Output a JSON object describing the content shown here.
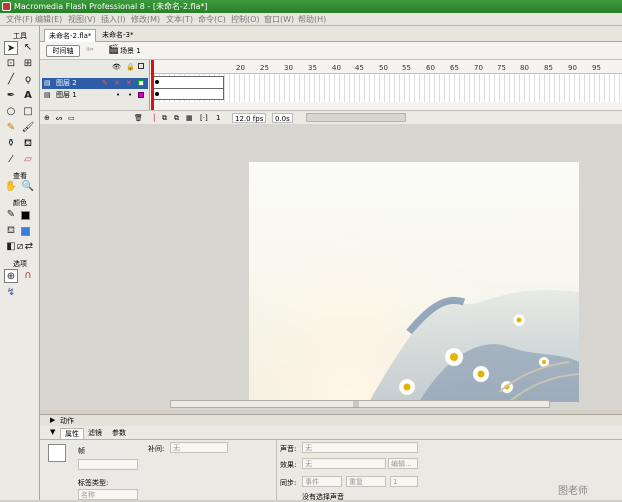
{
  "window": {
    "title": "Macromedia Flash Professional 8 - [未命名-2.fla*]"
  },
  "menubar": [
    "文件(F)",
    "编辑(E)",
    "视图(V)",
    "插入(I)",
    "修改(M)",
    "文本(T)",
    "命令(C)",
    "控制(O)",
    "窗口(W)",
    "帮助(H)"
  ],
  "tools": {
    "header": "工具",
    "view_header": "查看",
    "colors_header": "颜色",
    "options_header": "选项"
  },
  "doc_tabs": [
    "未命名-2.fla*",
    "未命名-3*"
  ],
  "timeline": {
    "button": "时间轴",
    "scene": "场景 1",
    "layers": [
      {
        "name": "图层 2",
        "selected": true
      },
      {
        "name": "图层 1",
        "selected": false
      }
    ],
    "ruler": [
      "20",
      "25",
      "30",
      "35",
      "40",
      "45",
      "50",
      "55",
      "60",
      "65",
      "70",
      "75",
      "80",
      "85",
      "90",
      "95"
    ],
    "frame": "1",
    "fps": "12.0 fps",
    "time": "0.0s"
  },
  "panels": {
    "actions": "动作",
    "tabs": [
      "属性",
      "滤镜",
      "参数"
    ],
    "frame_label": "帧",
    "tween_label": "补间:",
    "tween_value": "无",
    "frame_label_type": "标签类型:",
    "frame_label_type_value": "名称",
    "sound_label": "声音:",
    "sound_value": "无",
    "effect_label": "效果:",
    "effect_value": "无",
    "edit_button": "编辑...",
    "sync_label": "同步:",
    "sync_value": "事件",
    "repeat_value": "重复",
    "repeat_count": "1",
    "no_sound": "没有选择声音"
  },
  "watermark": "图老师",
  "colors": {
    "titlebar": "#2a7f2a",
    "selection": "#2e5ea8",
    "playhead": "#dd1111"
  }
}
